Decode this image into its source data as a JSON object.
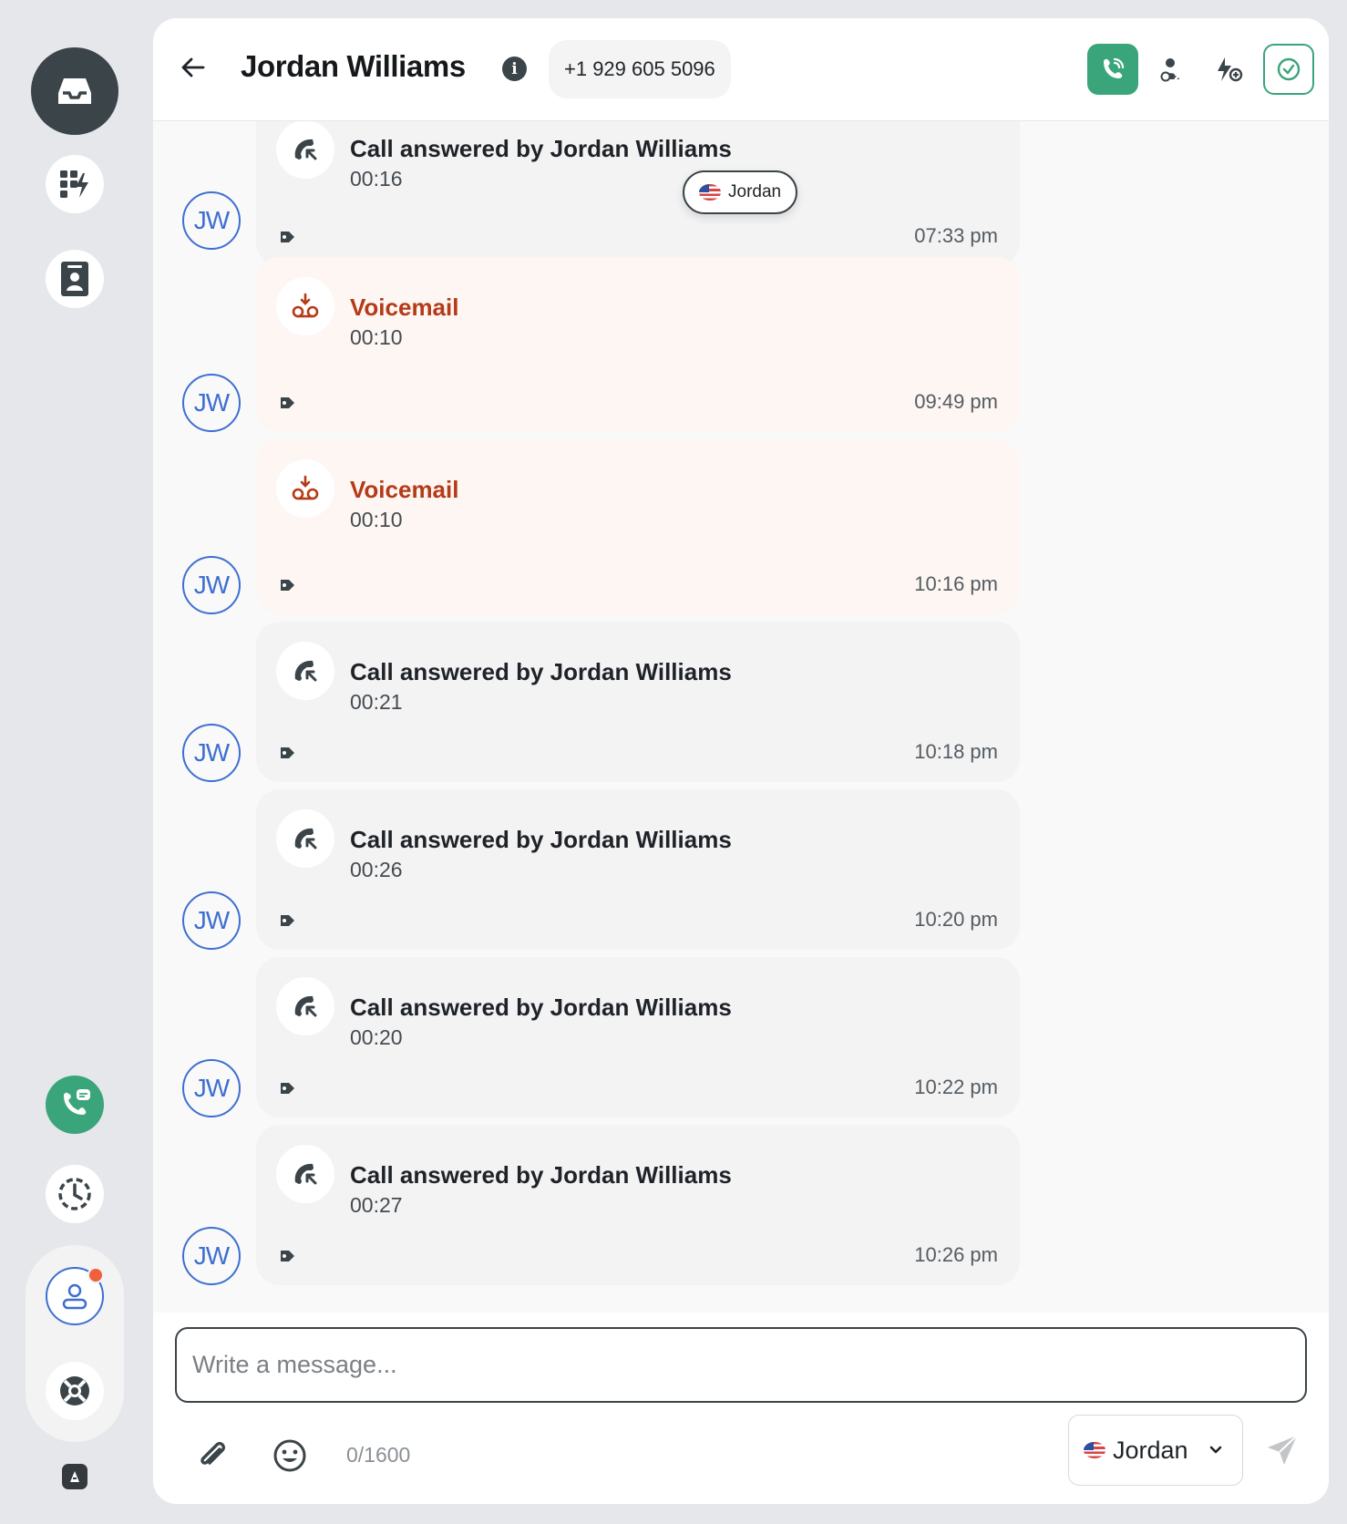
{
  "contact": {
    "name": "Jordan Williams",
    "phone": "+1 929 605 5096",
    "initials": "JW",
    "info_label": "i"
  },
  "floating_chip": {
    "label": "Jordan"
  },
  "events": [
    {
      "type": "call",
      "title": "Call answered by Jordan Williams",
      "duration": "00:16",
      "time": "07:33 pm"
    },
    {
      "type": "voicemail",
      "title": "Voicemail",
      "duration": "00:10",
      "time": "09:49 pm"
    },
    {
      "type": "voicemail",
      "title": "Voicemail",
      "duration": "00:10",
      "time": "10:16 pm"
    },
    {
      "type": "call",
      "title": "Call answered by Jordan Williams",
      "duration": "00:21",
      "time": "10:18 pm"
    },
    {
      "type": "call",
      "title": "Call answered by Jordan Williams",
      "duration": "00:26",
      "time": "10:20 pm"
    },
    {
      "type": "call",
      "title": "Call answered by Jordan Williams",
      "duration": "00:20",
      "time": "10:22 pm"
    },
    {
      "type": "call",
      "title": "Call answered by Jordan Williams",
      "duration": "00:27",
      "time": "10:26 pm"
    }
  ],
  "composer": {
    "placeholder": "Write a message...",
    "counter": "0/1600",
    "sender": "Jordan"
  },
  "colors": {
    "accent_green": "#3aa57a",
    "voicemail_red": "#b53a17",
    "avatar_blue": "#3e6fd0",
    "notification": "#f0603c"
  },
  "icons": {
    "rail": [
      "inbox-icon",
      "quick-actions-icon",
      "contacts-book-icon",
      "phone-message-icon",
      "history-icon",
      "profile-icon",
      "help-lifebuoy-icon",
      "app-logo-icon"
    ],
    "header": [
      "back-arrow-icon",
      "info-icon",
      "call-icon",
      "assign-user-icon",
      "automation-icon",
      "mark-done-icon"
    ],
    "events": [
      "incoming-call-icon",
      "voicemail-icon",
      "tag-icon"
    ],
    "composer": [
      "attachment-icon",
      "emoji-icon",
      "chevron-down-icon",
      "send-icon",
      "us-flag-icon"
    ]
  }
}
